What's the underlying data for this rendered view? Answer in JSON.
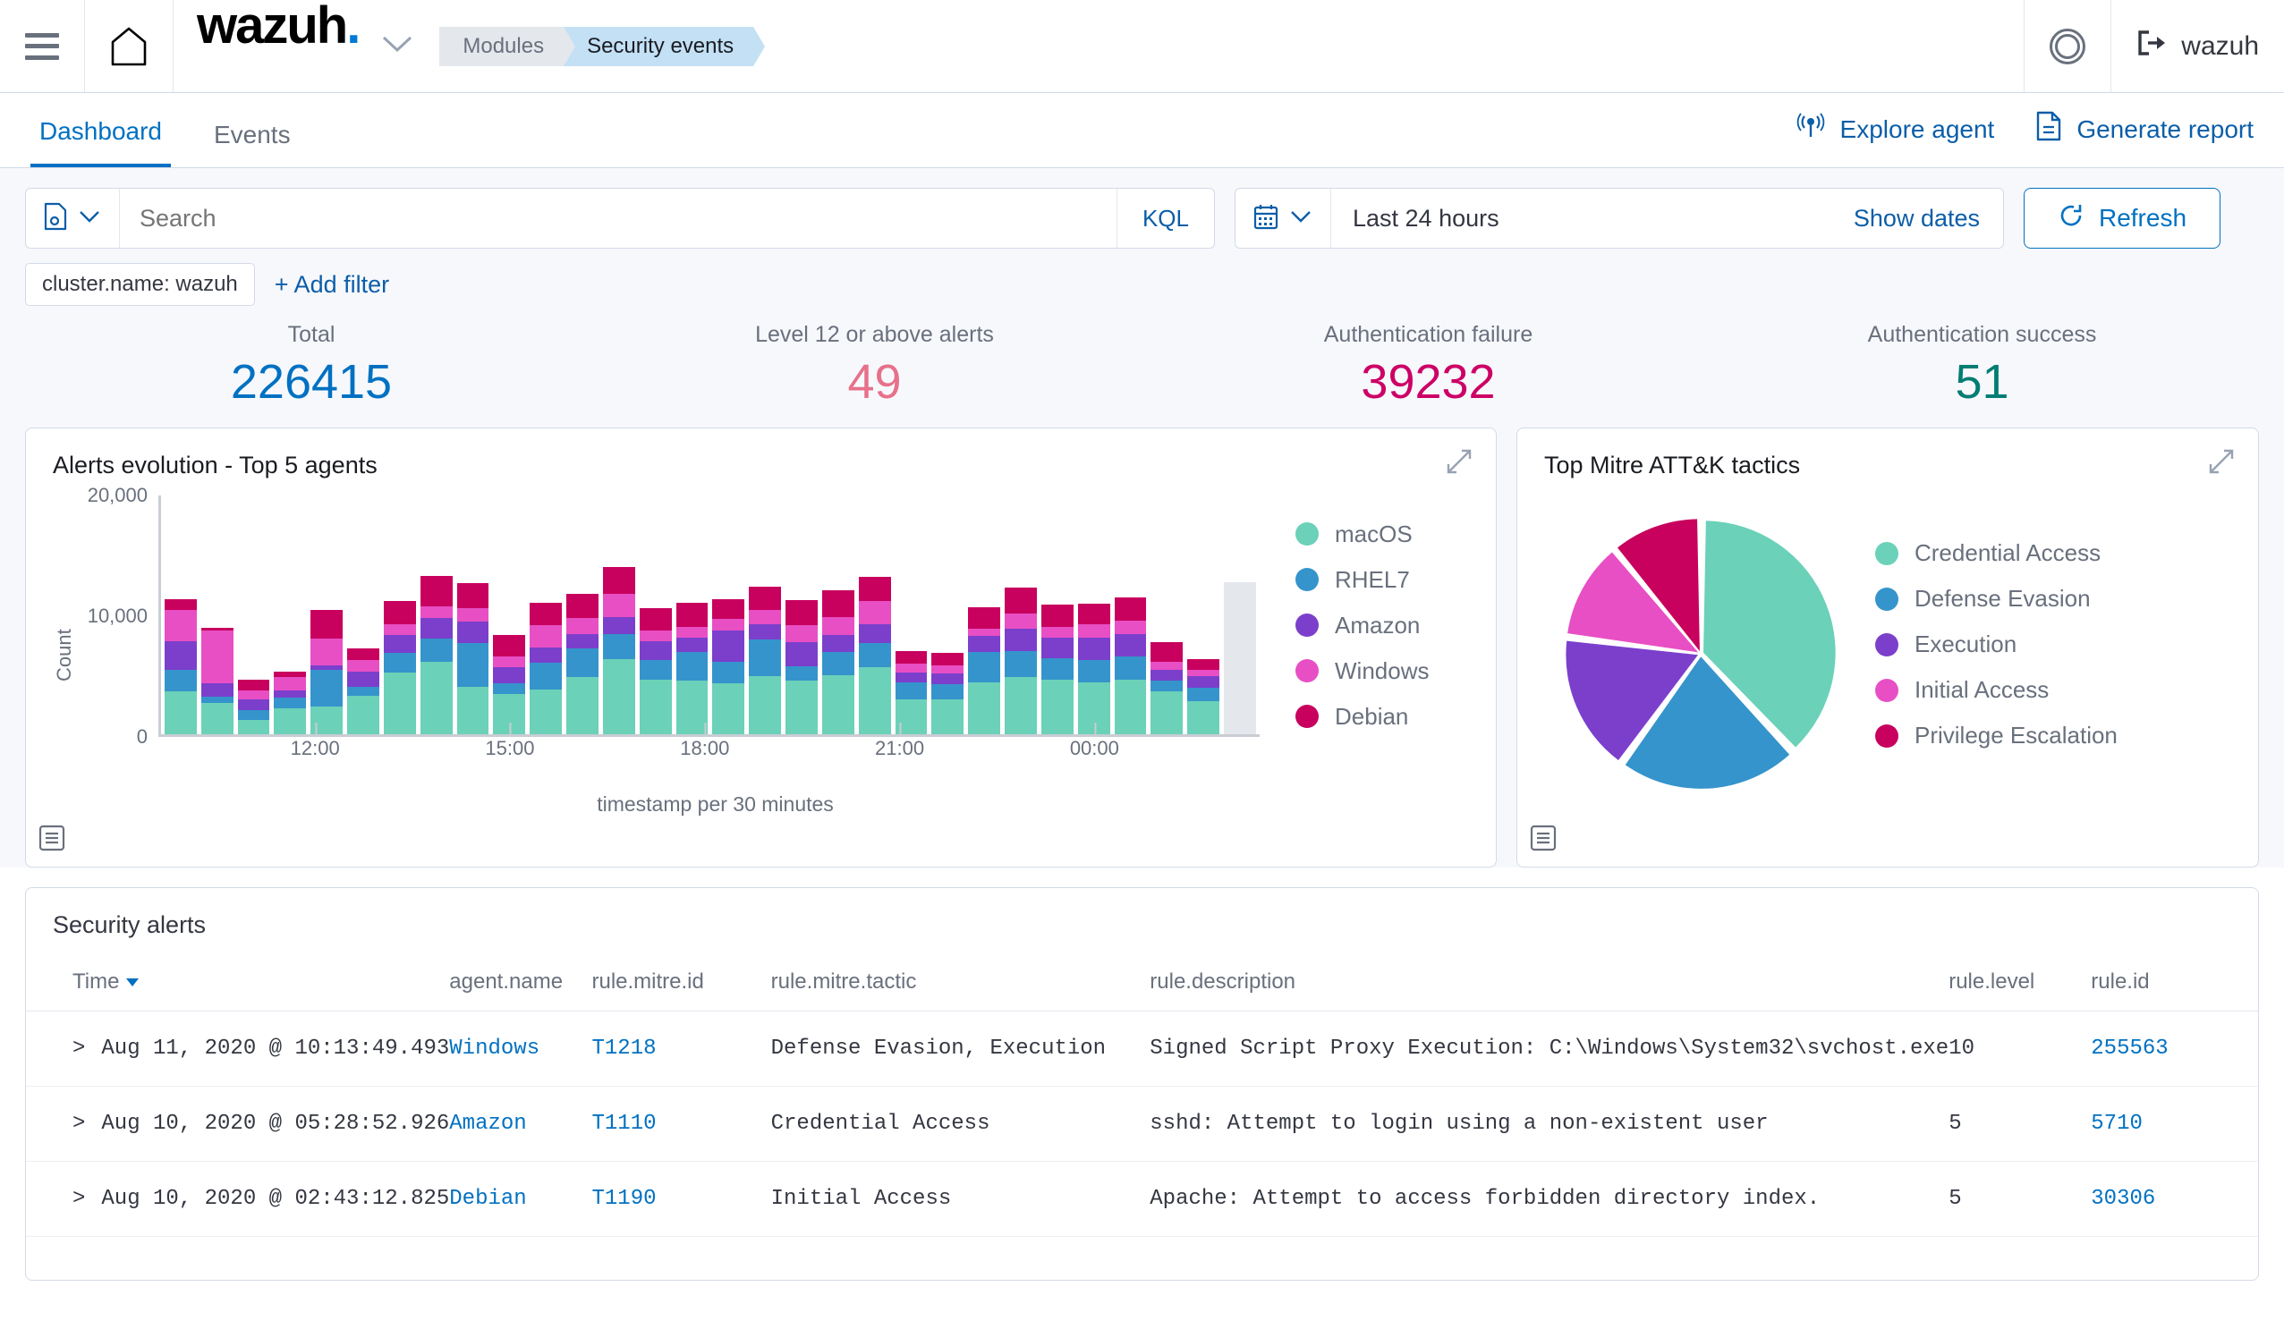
{
  "header": {
    "menu_icon": "hamburger-menu-icon",
    "home_icon": "home-icon",
    "brand": "wazuh",
    "brand_dot": ".",
    "breadcrumb_modules": "Modules",
    "breadcrumb_current": "Security events",
    "help_icon": "ring-icon",
    "user": "wazuh",
    "logout_icon": "logout-icon"
  },
  "nav": {
    "tabs": [
      {
        "label": "Dashboard",
        "active": true
      },
      {
        "label": "Events",
        "active": false
      }
    ],
    "actions": [
      {
        "label": "Explore agent",
        "icon": "antenna-icon"
      },
      {
        "label": "Generate report",
        "icon": "document-icon"
      }
    ]
  },
  "query": {
    "saved_query_icon": "saved-query-icon",
    "search_value": "",
    "search_placeholder": "Search",
    "kql_label": "KQL",
    "calendar_icon": "calendar-icon",
    "date_range": "Last 24 hours",
    "show_dates": "Show dates",
    "refresh_label": "Refresh",
    "refresh_icon": "refresh-icon"
  },
  "filters": {
    "pill": "cluster.name: wazuh",
    "add_filter": "+ Add filter"
  },
  "metrics": [
    {
      "label": "Total",
      "value": "226415",
      "color": "#0071c2"
    },
    {
      "label": "Level 12 or above alerts",
      "value": "49",
      "color": "#e7718a"
    },
    {
      "label": "Authentication failure",
      "value": "39232",
      "color": "#cc0066"
    },
    {
      "label": "Authentication success",
      "value": "51",
      "color": "#017d73"
    }
  ],
  "panels": {
    "alerts_evolution": {
      "title": "Alerts evolution - Top 5 agents",
      "expand_icon": "expand-icon",
      "inspect_icon": "inspect-icon"
    },
    "mitre": {
      "title": "Top Mitre ATT&K tactics",
      "expand_icon": "expand-icon",
      "inspect_icon": "inspect-icon"
    }
  },
  "chart_data": [
    {
      "type": "bar",
      "stacked": true,
      "title": "Alerts evolution - Top 5 agents",
      "xlabel": "timestamp per 30 minutes",
      "ylabel": "Count",
      "ylim": [
        0,
        20000
      ],
      "yticks": [
        0,
        10000,
        20000
      ],
      "ytick_labels": [
        "0",
        "10,000",
        "20,000"
      ],
      "xtick_labels": [
        "12:00",
        "15:00",
        "18:00",
        "21:00",
        "00:00"
      ],
      "xtick_positions": [
        0.1423,
        0.3192,
        0.4962,
        0.6731,
        0.85
      ],
      "grid": false,
      "legend_position": "right",
      "series": [
        {
          "name": "macOS",
          "color": "#6bd1b8",
          "values": [
            3500,
            2600,
            1200,
            2100,
            2300,
            3200,
            5100,
            6000,
            3900,
            3300,
            3700,
            4700,
            6200,
            4500,
            4400,
            4200,
            4800,
            4400,
            4900,
            5500,
            2900,
            2900,
            4300,
            4700,
            4500,
            4300,
            4500,
            3500,
            2700,
            0
          ]
        },
        {
          "name": "RHEL7",
          "color": "#3594cb",
          "values": [
            1800,
            500,
            800,
            900,
            3000,
            700,
            1600,
            1900,
            3600,
            900,
            2200,
            2400,
            2100,
            1600,
            2400,
            1800,
            3000,
            1200,
            1900,
            2000,
            1400,
            1200,
            2500,
            2200,
            1800,
            1800,
            1900,
            900,
            1100,
            0
          ]
        },
        {
          "name": "Amazon",
          "color": "#7b3fcc",
          "values": [
            2400,
            1100,
            900,
            600,
            400,
            1300,
            1500,
            1700,
            1800,
            1300,
            1300,
            1200,
            1400,
            1600,
            1200,
            2600,
            1300,
            2000,
            1400,
            1600,
            800,
            900,
            1300,
            1800,
            1700,
            1900,
            1900,
            900,
            1000,
            0
          ]
        },
        {
          "name": "Windows",
          "color": "#e84fc4",
          "values": [
            2600,
            4400,
            700,
            1100,
            2200,
            900,
            900,
            1000,
            1100,
            900,
            1800,
            1300,
            1900,
            900,
            900,
            900,
            1200,
            1400,
            1500,
            1900,
            700,
            700,
            600,
            1300,
            900,
            1100,
            1100,
            700,
            500,
            0
          ]
        },
        {
          "name": "Debian",
          "color": "#c8005e",
          "values": [
            900,
            200,
            900,
            500,
            2400,
            1000,
            1900,
            2500,
            2100,
            1800,
            1900,
            2000,
            2200,
            1800,
            2000,
            1700,
            1900,
            2100,
            2200,
            2000,
            1100,
            1000,
            1800,
            2100,
            1800,
            1700,
            1900,
            1600,
            900,
            0
          ]
        }
      ],
      "ghost_bar": true
    },
    {
      "type": "pie",
      "title": "Top Mitre ATT&K tactics",
      "legend_position": "right",
      "labels": [
        "Credential Access",
        "Defense Evasion",
        "Execution",
        "Initial Access",
        "Privilege Escalation"
      ],
      "values": [
        38,
        22,
        17,
        12,
        11
      ],
      "colors": [
        "#6bd1b8",
        "#3594cb",
        "#7b3fcc",
        "#e84fc4",
        "#c8005e"
      ]
    }
  ],
  "table": {
    "title": "Security alerts",
    "columns": [
      {
        "key": "time",
        "label": "Time",
        "sorted": true
      },
      {
        "key": "agent",
        "label": "agent.name"
      },
      {
        "key": "mitre_id",
        "label": "rule.mitre.id"
      },
      {
        "key": "tactic",
        "label": "rule.mitre.tactic"
      },
      {
        "key": "description",
        "label": "rule.description"
      },
      {
        "key": "level",
        "label": "rule.level"
      },
      {
        "key": "rule_id",
        "label": "rule.id"
      }
    ],
    "rows": [
      {
        "time": "Aug 11, 2020 @ 10:13:49.493",
        "agent": "Windows",
        "mitre_id": "T1218",
        "tactic": "Defense Evasion, Execution",
        "description": "Signed Script Proxy Execution: C:\\Windows\\System32\\svchost.exe",
        "level": "10",
        "rule_id": "255563"
      },
      {
        "time": "Aug 10, 2020 @ 05:28:52.926",
        "agent": "Amazon",
        "mitre_id": "T1110",
        "tactic": "Credential Access",
        "description": "sshd: Attempt to login using a non-existent user",
        "level": "5",
        "rule_id": "5710"
      },
      {
        "time": "Aug 10, 2020 @ 02:43:12.825",
        "agent": "Debian",
        "mitre_id": "T1190",
        "tactic": "Initial Access",
        "description": "Apache: Attempt to access forbidden directory index.",
        "level": "5",
        "rule_id": "30306"
      }
    ]
  }
}
